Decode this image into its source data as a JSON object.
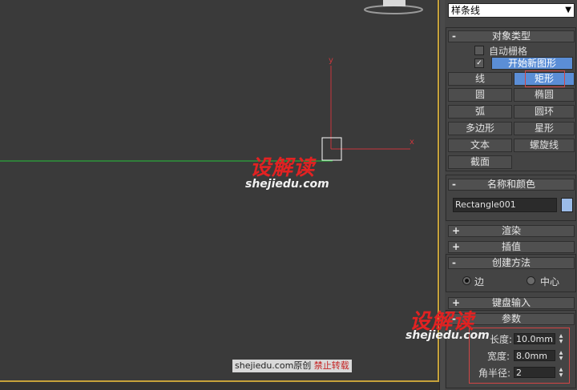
{
  "viewport": {
    "axis_y_label": "y",
    "axis_x_label": "x",
    "colors": {
      "grid_line": "#26c33a",
      "axis": "#c8373c",
      "border": "#c6a23a"
    }
  },
  "panel": {
    "category_dropdown": "样条线",
    "object_type": {
      "title": "对象类型",
      "autogrid_label": "自动栅格",
      "start_new_shape_label": "开始新图形",
      "buttons": [
        "线",
        "矩形",
        "圆",
        "椭圆",
        "弧",
        "圆环",
        "多边形",
        "星形",
        "文本",
        "螺旋线",
        "截面"
      ]
    },
    "name_color": {
      "title": "名称和颜色",
      "name_value": "Rectangle001",
      "swatch_color": "#9bbbe8"
    },
    "rendering": {
      "title": "渲染"
    },
    "interpolation": {
      "title": "插值"
    },
    "creation_method": {
      "title": "创建方法",
      "edge_label": "边",
      "center_label": "中心"
    },
    "keyboard_entry": {
      "title": "键盘输入"
    },
    "parameters": {
      "title": "参数",
      "length_label": "长度:",
      "length_value": "10.0mm",
      "width_label": "宽度:",
      "width_value": "8.0mm",
      "corner_label": "角半径:",
      "corner_value": "2"
    }
  },
  "watermark": {
    "logo_text": "设解读",
    "url_text": "shejiedu.com",
    "banner_site": "shejiedu.com",
    "banner_original": "原创",
    "banner_no_repost": "禁止转载"
  }
}
